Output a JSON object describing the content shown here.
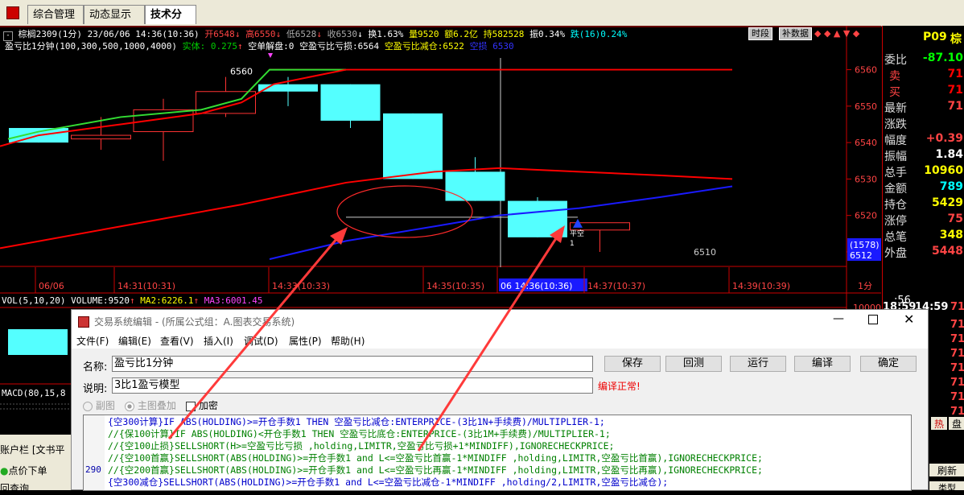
{
  "tabs": [
    "综合管理",
    "动态显示牌",
    "技术分析"
  ],
  "info1": {
    "symbol": "棕榈2309(1分)",
    "datetime": "23/06/06 14:36(10:36)",
    "open": "开6548",
    "high": "高6550",
    "low": "低6528",
    "close": "收6530",
    "turnover": "换1.63%",
    "volume": "量9520",
    "amount": "额6.2亿",
    "position": "持582528",
    "amplitude": "振0.34%",
    "change": "跌(16)0.24%",
    "btn_period": "时段",
    "btn_fill": "补数据"
  },
  "info2": {
    "formula": "盈亏比1分钟(100,300,500,1000,4000)",
    "body": "实体: 0.275",
    "short_close": "空单解盘:0",
    "short_stop": "空盈亏比亏损:6564",
    "short_reduce": "空盈亏比减仓:6522",
    "empty_label": "空损",
    "empty_val": "6530"
  },
  "chart_data": {
    "type": "candlestick",
    "ylim": [
      6508,
      6563
    ],
    "y_ticks": [
      6510,
      6520,
      6530,
      6540,
      6550,
      6560
    ],
    "candles": [
      {
        "o": 6544,
        "c": 6540,
        "h": 6544,
        "l": 6540,
        "up": false
      },
      {
        "o": 6542,
        "c": 6541,
        "h": 6547,
        "l": 6538,
        "up": true
      },
      {
        "o": 6543,
        "c": 6549,
        "h": 6552,
        "l": 6535,
        "up": true
      },
      {
        "o": 6548,
        "c": 6554,
        "h": 6558,
        "l": 6547,
        "up": true
      },
      {
        "o": 6556,
        "c": 6554,
        "h": 6558,
        "l": 6550,
        "up": false
      },
      {
        "o": 6556,
        "c": 6546,
        "h": 6556,
        "l": 6544,
        "up": false
      },
      {
        "o": 6548,
        "c": 6530,
        "h": 6548,
        "l": 6530,
        "up": false
      },
      {
        "o": 6532,
        "c": 6524,
        "h": 6536,
        "l": 6524,
        "up": false
      },
      {
        "o": 6524,
        "c": 6514,
        "h": 6525,
        "l": 6514,
        "up": false
      },
      {
        "o": 6518,
        "c": 6516,
        "h": 6518,
        "l": 6510,
        "up": true
      }
    ],
    "price_6560": "6560",
    "price_6510": "6510",
    "marker_label": "平空",
    "marker_sub": "1",
    "x_labels": [
      "06/06",
      "14:31(10:31)",
      "14:33(10:33)",
      "14:35(10:35)",
      "06 14:36(10:36)",
      "14:37(10:37)",
      "14:39(10:39)"
    ],
    "cursor_vals": [
      "(1578)",
      "6512"
    ],
    "period": "1分"
  },
  "vol": {
    "label": "VOL(5,10,20)",
    "volume": "VOLUME:9520",
    "ma2": "MA2:6226.1",
    "ma3": "MA3:6001.45",
    "right_tick": "10000"
  },
  "macd": {
    "label": "MACD(80,15,8"
  },
  "right_panel": {
    "code": "P09",
    "code2": "棕",
    "rows": [
      {
        "label": "委比",
        "value": "-87.10",
        "color": "#00ff00"
      },
      {
        "label": "卖",
        "value": "71",
        "color": "#ff0000"
      },
      {
        "label": "买",
        "value": "71",
        "color": "#ff0000"
      },
      {
        "label": "最新",
        "value": "71",
        "color": "#ff4444"
      },
      {
        "label": "涨跌",
        "value": "",
        "color": "#ffffff"
      },
      {
        "label": "幅度",
        "value": "+0.39",
        "color": "#ff4444"
      },
      {
        "label": "振幅",
        "value": "1.84",
        "color": "#ffffff"
      },
      {
        "label": "总手",
        "value": "10960",
        "color": "#ffff00"
      },
      {
        "label": "金额",
        "value": "789",
        "color": "#00ffff"
      },
      {
        "label": "持仓",
        "value": "5429",
        "color": "#ffff00"
      },
      {
        "label": "涨停",
        "value": "75",
        "color": "#ff4444"
      },
      {
        "label": "总笔",
        "value": "348",
        "color": "#ffff00"
      },
      {
        "label": "外盘",
        "value": "5448",
        "color": "#ff4444"
      }
    ],
    "time1": "18:59",
    "time2": "14:59",
    "time_val": "71",
    "time3": ":56",
    "tick_vals": [
      "71",
      "71",
      "71",
      "71",
      "71",
      "71",
      "71",
      "71"
    ],
    "btn_hot": "热",
    "btn_pan": "盘"
  },
  "bottom_left": {
    "account": "账户栏 [文书平",
    "order": "点价下单",
    "query": "回查询"
  },
  "bottom_right": {
    "refresh": "刷新",
    "cat": "类型"
  },
  "dialog": {
    "title": "交易系统编辑 - (所属公式组：A.图表交易系统)",
    "menu": [
      "文件(F)",
      "编辑(E)",
      "查看(V)",
      "插入(I)",
      "调试(D)",
      "属性(P)",
      "帮助(H)"
    ],
    "name_label": "名称:",
    "name_value": "盈亏比1分钟",
    "desc_label": "说明:",
    "desc_value": "3比1盈亏模型",
    "status": "编译正常!",
    "radio1": "副图",
    "radio2": "主图叠加",
    "check": "加密",
    "buttons": [
      "保存",
      "回测",
      "运行",
      "编译",
      "确定"
    ],
    "line_no": "290",
    "code_lines": [
      {
        "text": "{空300计算}IF ABS(HOLDING)>=开仓手数1                 THEN 空盈亏比减仓:ENTERPRICE-(3比1N+手续费)/MULTIPLIER-1;",
        "color": "#0000cc"
      },
      {
        "text": "//{保100计算}IF ABS(HOLDING)<开仓手数1                 THEN 空盈亏比底仓:ENTERPRICE-(3比1M+手续费)/MULTIPLIER-1;",
        "color": "#008000"
      },
      {
        "text": "//{空100止损}SELLSHORT(H>=空盈亏比亏损 ,holding,LIMITR,空盈亏比亏损+1*MINDIFF),IGNORECHECKPRICE;",
        "color": "#008000"
      },
      {
        "text": "//{空100首赢}SELLSHORT(ABS(HOLDING)>=开仓手数1 and L<=空盈亏比首赢-1*MINDIFF ,holding,LIMITR,空盈亏比首赢),IGNORECHECKPRICE;",
        "color": "#008000"
      },
      {
        "text": "//{空200首赢}SELLSHORT(ABS(HOLDING)>=开仓手数1 and L<=空盈亏比再赢-1*MINDIFF ,holding,LIMITR,空盈亏比再赢),IGNORECHECKPRICE;",
        "color": "#008000"
      },
      {
        "text": "{空300减仓}SELLSHORT(ABS(HOLDING)>=开仓手数1 and L<=空盈亏比减仓-1*MINDIFF ,holding/2,LIMITR,空盈亏比减仓);",
        "color": "#0000cc"
      }
    ]
  },
  "colors": {
    "accent_red": "#ff0000",
    "candle_down": "#54ffff",
    "candle_up": "#ff3333",
    "ma_green": "#33dd33",
    "ma_blue": "#1a1aff"
  }
}
